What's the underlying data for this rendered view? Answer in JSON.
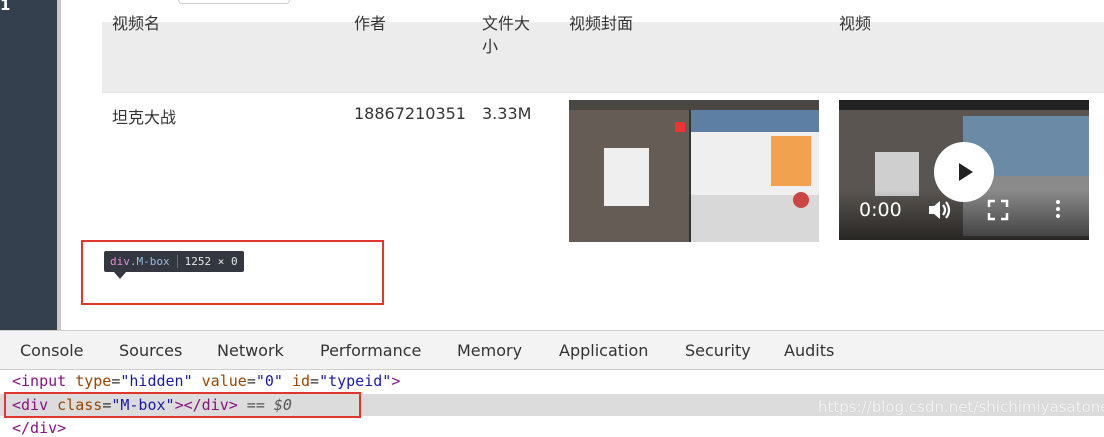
{
  "sidebar": {
    "number": "1"
  },
  "table": {
    "headers": [
      "视频名",
      "作者",
      "文件大小",
      "视频封面",
      "视频"
    ],
    "row": {
      "name": "坦克大战",
      "author": "18867210351",
      "size": "3.33M"
    }
  },
  "video_player": {
    "time": "0:00"
  },
  "tooltip": {
    "tag": "div",
    "class": ".M-box",
    "dims": "1252 × 0"
  },
  "devtools": {
    "tabs": [
      "Console",
      "Sources",
      "Network",
      "Performance",
      "Memory",
      "Application",
      "Security",
      "Audits"
    ],
    "code": {
      "line1": {
        "open": "<input ",
        "attr1": "type",
        "val1": "\"hidden\"",
        "attr2": "value",
        "val2": "\"0\"",
        "attr3": "id",
        "val3": "\"typeid\"",
        "close": ">"
      },
      "line2": {
        "open": "<div ",
        "attr": "class",
        "val": "\"M-box\"",
        "close": "></div>",
        "suffix": " == $0"
      },
      "line3": "</div>"
    }
  },
  "watermark": "https://blog.csdn.net/shichimiyasatone",
  "colors": {
    "highlight_box": "#e0362e",
    "tooltip_bg": "#333740"
  }
}
